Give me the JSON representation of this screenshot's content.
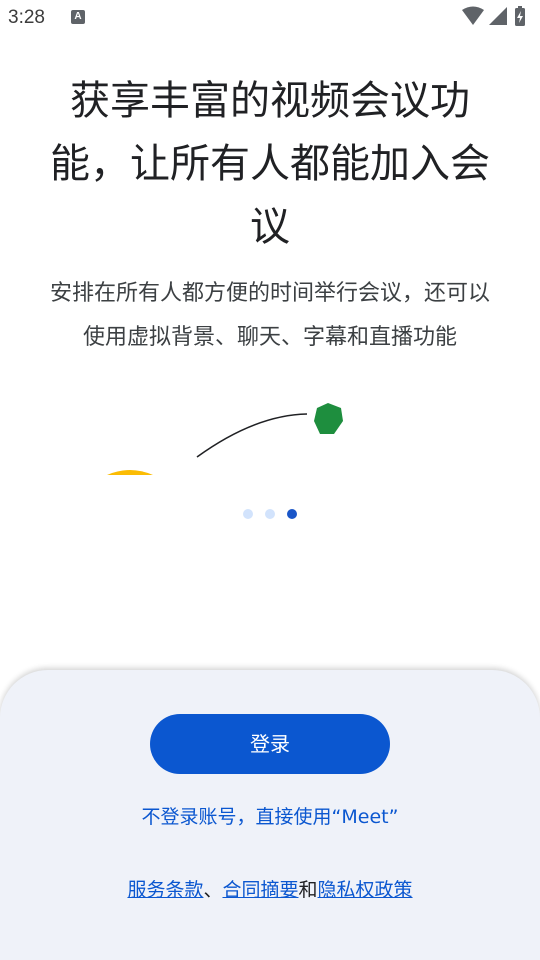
{
  "status_bar": {
    "time": "3:28",
    "notification_icon": "A",
    "icons": [
      "wifi-icon",
      "signal-icon",
      "battery-charging-icon"
    ]
  },
  "onboarding": {
    "headline_line1": "获享丰富的视频会议功",
    "headline_line2": "能，让所有人都能加入会",
    "headline_line3": "议",
    "subtitle_line1": "安排在所有人都方便的时间举行会议，还可以",
    "subtitle_line2": "使用虚拟背景、聊天、字幕和直播功能",
    "page_count": 3,
    "current_page": 3,
    "illustration_colors": {
      "hexagon": "#1e8e3e",
      "arc": "#fbbc04",
      "line": "#202124"
    }
  },
  "sheet": {
    "signin_label": "登录",
    "guest_label": "不登录账号，直接使用“Meet”",
    "terms_label": "服务条款",
    "separator": "、",
    "contract_label": "合同摘要",
    "and_label": "和",
    "privacy_label": "隐私权政策"
  },
  "colors": {
    "primary": "#0b57d0",
    "sheet_bg": "#eff2f9",
    "dot_inactive": "#d2e3fc",
    "dot_active": "#1a56c8"
  }
}
